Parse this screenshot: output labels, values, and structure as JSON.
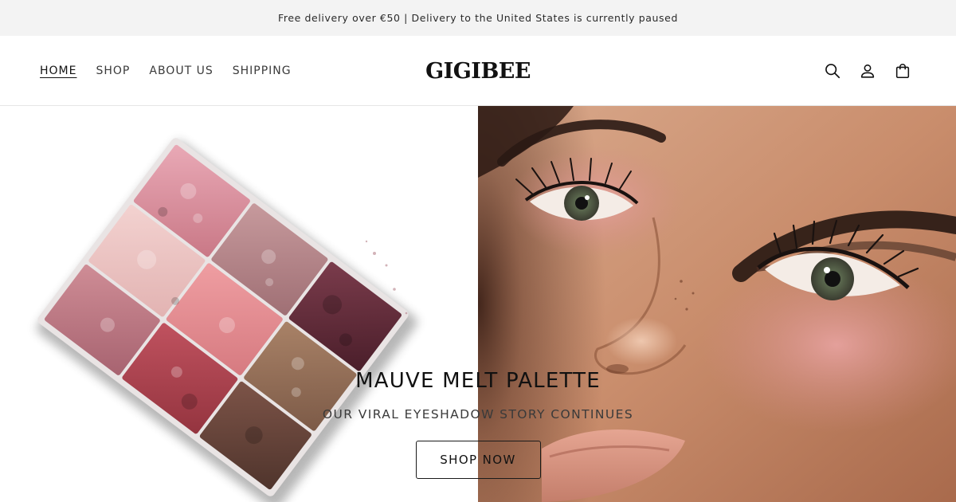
{
  "announcement": {
    "text": "Free delivery over €50 | Delivery to the United States is currently paused"
  },
  "header": {
    "logo": "GIGIBEE",
    "nav": [
      {
        "label": "HOME",
        "active": true
      },
      {
        "label": "SHOP",
        "active": false
      },
      {
        "label": "ABOUT US",
        "active": false
      },
      {
        "label": "SHIPPING",
        "active": false
      }
    ],
    "icons": [
      "search-icon",
      "account-icon",
      "cart-icon"
    ]
  },
  "hero": {
    "title": "MAUVE MELT PALETTE",
    "subtitle": "OUR VIRAL EYESHADOW STORY CONTINUES",
    "button_label": "SHOP NOW",
    "images": [
      "eyeshadow-palette-image",
      "model-face-image"
    ]
  },
  "colors": {
    "announcement_bg": "#f3f3f3",
    "text": "#121212",
    "palette_pink": "#d98a96",
    "palette_plum": "#5a2634",
    "palette_brown": "#6b4a3e",
    "skin": "#c98d6c"
  }
}
